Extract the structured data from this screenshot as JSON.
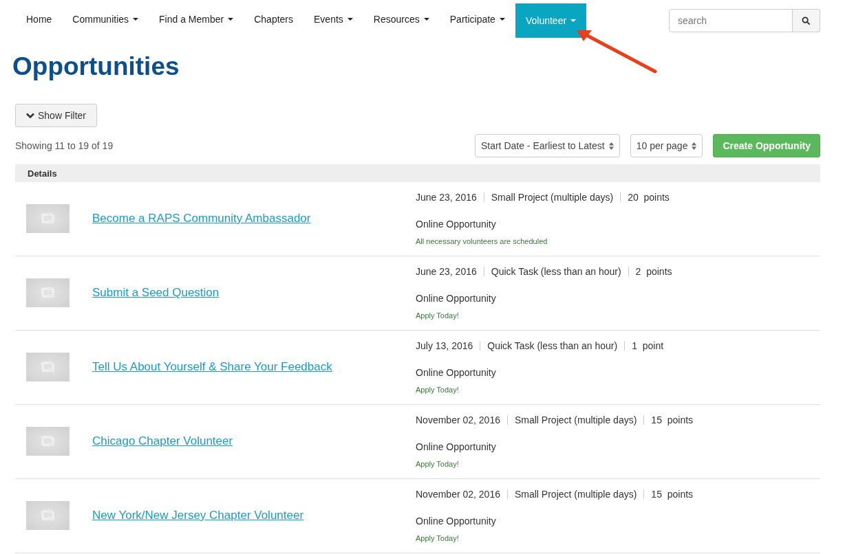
{
  "nav": [
    {
      "label": "Home",
      "has_menu": false,
      "selected": false
    },
    {
      "label": "Communities",
      "has_menu": true,
      "selected": false
    },
    {
      "label": "Find a Member",
      "has_menu": true,
      "selected": false
    },
    {
      "label": "Chapters",
      "has_menu": false,
      "selected": false
    },
    {
      "label": "Events",
      "has_menu": true,
      "selected": false
    },
    {
      "label": "Resources",
      "has_menu": true,
      "selected": false
    },
    {
      "label": "Participate",
      "has_menu": true,
      "selected": false
    },
    {
      "label": "Volunteer",
      "has_menu": true,
      "selected": true
    }
  ],
  "search": {
    "placeholder": "search"
  },
  "title": "Opportunities",
  "filter_button": "Show Filter",
  "showing": "Showing 11 to 19 of 19",
  "sort_select": "Start Date - Earliest to Latest",
  "per_page_select": "10 per page",
  "create_button": "Create Opportunity",
  "table": {
    "header": "Details",
    "rows": [
      {
        "title": "Become a RAPS Community Ambassador",
        "date": "June 23, 2016",
        "type": "Small Project (multiple days)",
        "points": "20  points",
        "location": "Online Opportunity",
        "status": "All necessary volunteers are scheduled"
      },
      {
        "title": "Submit a Seed Question",
        "date": "June 23, 2016",
        "type": "Quick Task (less than an hour)",
        "points": "2  points",
        "location": "Online Opportunity",
        "status": "Apply Today!"
      },
      {
        "title": "Tell Us About Yourself & Share Your Feedback",
        "date": "July 13, 2016",
        "type": "Quick Task (less than an hour)",
        "points": "1  point",
        "location": "Online Opportunity",
        "status": "Apply Today!"
      },
      {
        "title": "Chicago Chapter Volunteer",
        "date": "November 02, 2016",
        "type": "Small Project (multiple days)",
        "points": "15  points",
        "location": "Online Opportunity",
        "status": "Apply Today!"
      },
      {
        "title": "New York/New Jersey Chapter Volunteer",
        "date": "November 02, 2016",
        "type": "Small Project (multiple days)",
        "points": "15  points",
        "location": "Online Opportunity",
        "status": "Apply Today!"
      }
    ]
  }
}
